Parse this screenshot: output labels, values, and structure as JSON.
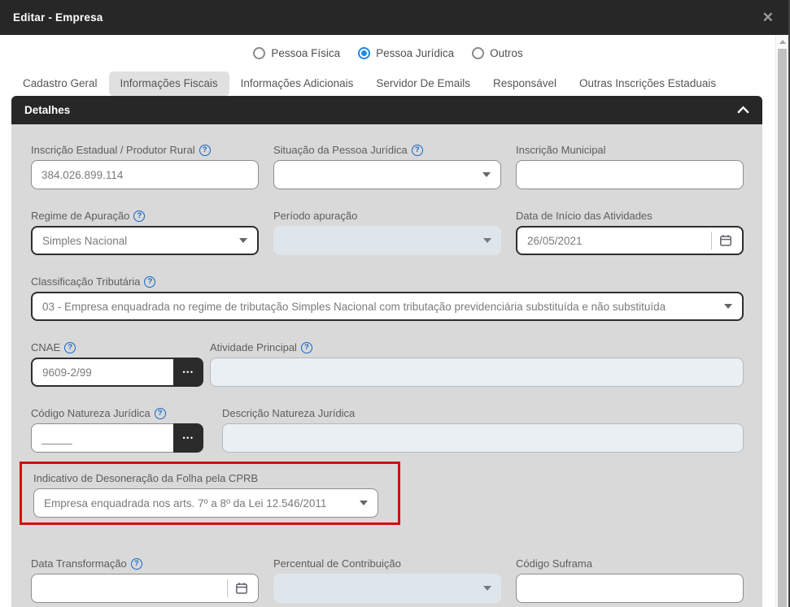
{
  "window": {
    "title": "Editar - Empresa"
  },
  "icons": {
    "close": "✕",
    "info": "?",
    "ellipsis": "•••"
  },
  "colors": {
    "header_bg": "#272727",
    "panel_gray": "#d9d9d9",
    "accent_blue": "#1e88e5",
    "highlight_red": "#cf0f0f",
    "active_tab_bg": "#e0e0e0",
    "disabled_field_bg": "#dfe6eb",
    "readonly_field_bg": "#e9eff3"
  },
  "person_type": {
    "options": [
      {
        "label": "Pessoa Física",
        "selected": false
      },
      {
        "label": "Pessoa Jurídica",
        "selected": true
      },
      {
        "label": "Outros",
        "selected": false
      }
    ],
    "selected": "Pessoa Jurídica"
  },
  "tabs": [
    {
      "label": "Cadastro Geral",
      "active": false
    },
    {
      "label": "Informações Fiscais",
      "active": true
    },
    {
      "label": "Informações Adicionais",
      "active": false
    },
    {
      "label": "Servidor De Emails",
      "active": false
    },
    {
      "label": "Responsável",
      "active": false
    },
    {
      "label": "Outras Inscrições Estaduais",
      "active": false
    }
  ],
  "section": {
    "title": "Detalhes"
  },
  "fields": {
    "inscricao_estadual": {
      "label": "Inscrição Estadual / Produtor Rural",
      "value": "384.026.899.114"
    },
    "situacao_pessoa_juridica": {
      "label": "Situação da Pessoa Jurídica",
      "value": ""
    },
    "inscricao_municipal": {
      "label": "Inscrição Municipal",
      "value": ""
    },
    "regime_apuracao": {
      "label": "Regime de Apuração",
      "value": "Simples Nacional"
    },
    "periodo_apuracao": {
      "label": "Período apuração",
      "value": ""
    },
    "data_inicio_atividades": {
      "label": "Data de Início das Atividades",
      "value": "26/05/2021"
    },
    "classificacao_tributaria": {
      "label": "Classificação Tributária",
      "value": "03 - Empresa enquadrada no regime de tributação Simples Nacional com tributação previdenciária substituída e não substituída"
    },
    "cnae": {
      "label": "CNAE",
      "value": "9609-2/99"
    },
    "atividade_principal": {
      "label": "Atividade Principal",
      "value": ""
    },
    "codigo_natureza_juridica": {
      "label": "Código Natureza Jurídica",
      "value": "_____"
    },
    "descricao_natureza_juridica": {
      "label": "Descrição Natureza Jurídica",
      "value": ""
    },
    "indicativo_desoneracao": {
      "label": "Indicativo de Desoneração da Folha pela CPRB",
      "value": "Empresa enquadrada nos arts. 7º a 8º da Lei 12.546/2011"
    },
    "data_transformacao": {
      "label": "Data Transformação",
      "value": ""
    },
    "percentual_contribuicao": {
      "label": "Percentual de Contribuição",
      "value": ""
    },
    "codigo_suframa": {
      "label": "Código Suframa",
      "value": ""
    }
  }
}
